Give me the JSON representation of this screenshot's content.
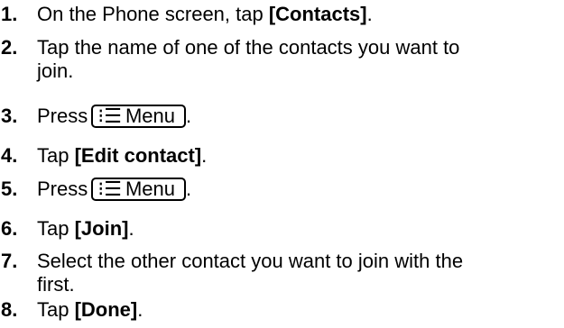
{
  "steps": [
    {
      "num": "1.",
      "pre": "On the Phone screen, tap ",
      "bold": "[Contacts]",
      "post": "."
    },
    {
      "num": "2.",
      "line1": "Tap the name of one of the contacts you want to",
      "line2": "join."
    },
    {
      "num": "3.",
      "pre": "Press",
      "key_icon": "menu-list-icon",
      "key_label": "Menu",
      "post": "."
    },
    {
      "num": "4.",
      "pre": "Tap ",
      "bold": "[Edit contact]",
      "post": "."
    },
    {
      "num": "5.",
      "pre": "Press",
      "key_icon": "menu-list-icon",
      "key_label": "Menu",
      "post": "."
    },
    {
      "num": "6.",
      "pre": "Tap ",
      "bold": "[Join]",
      "post": "."
    },
    {
      "num": "7.",
      "line1": "Select the other contact you want to join with the",
      "line2": "first."
    },
    {
      "num": "8.",
      "pre": "Tap ",
      "bold": "[Done]",
      "post": "."
    }
  ]
}
